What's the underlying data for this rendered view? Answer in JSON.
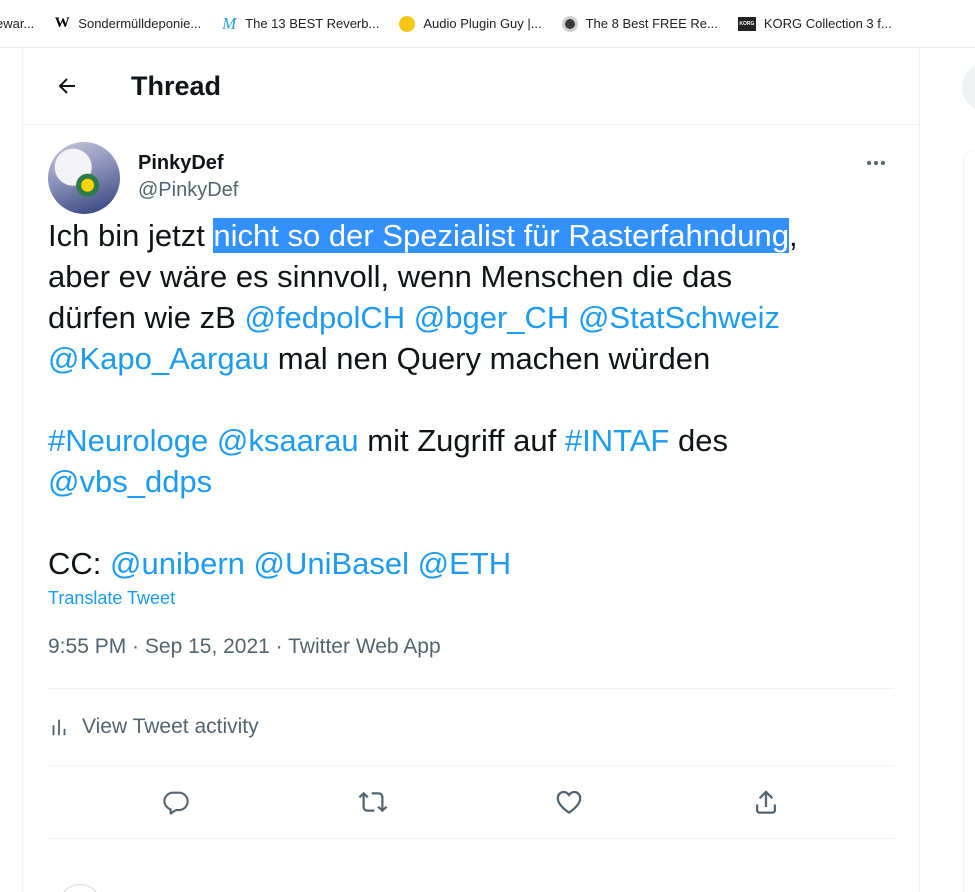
{
  "bookmarks": [
    {
      "label": "ewar...",
      "icon": "generic-page-icon"
    },
    {
      "label": "Sondermülldeponie...",
      "icon": "wikipedia-icon"
    },
    {
      "label": "The 13 BEST Reverb...",
      "icon": "m-logo-icon"
    },
    {
      "label": "Audio Plugin Guy |...",
      "icon": "audio-plugin-guy-icon"
    },
    {
      "label": "The 8 Best FREE Re...",
      "icon": "disc-icon"
    },
    {
      "label": "KORG Collection 3 f...",
      "icon": "korg-icon"
    }
  ],
  "header": {
    "title": "Thread",
    "back_icon": "arrow-left-icon"
  },
  "tweet": {
    "display_name": "PinkyDef",
    "handle": "@PinkyDef",
    "text": {
      "l1_a": "Ich bin jetzt ",
      "l1_sel": "nicht so der Spezialist für Rasterfahndung",
      "l1_b": ",",
      "l2": "aber ev wäre es sinnvoll, wenn Menschen die das",
      "l3_a": "dürfen wie zB ",
      "m_fedpol": "@fedpolCH",
      "m_bger": "@bger_CH",
      "m_stat": "@StatSchweiz",
      "m_kapo": "@Kapo_Aargau",
      "l4_b": " mal nen Query machen würden",
      "h_neuro": "#Neurologe",
      "m_ksaarau": "@ksaarau",
      "l5_b": " mit Zugriff auf ",
      "h_intaf": "#INTAF",
      "l5_c": " des",
      "m_vbs": "@vbs_ddps",
      "cc": "CC: ",
      "m_unibern": "@unibern",
      "m_unibasel": "@UniBasel",
      "m_eth": "@ETH",
      "space": " "
    },
    "translate": "Translate Tweet",
    "time": "9:55 PM",
    "sep": " · ",
    "date": "Sep 15, 2021",
    "client": "Twitter Web App",
    "activity": "View Tweet activity"
  },
  "colors": {
    "link": "#1d9bf0",
    "selection": "#3390ff",
    "muted": "#536471",
    "text": "#0f1419"
  }
}
